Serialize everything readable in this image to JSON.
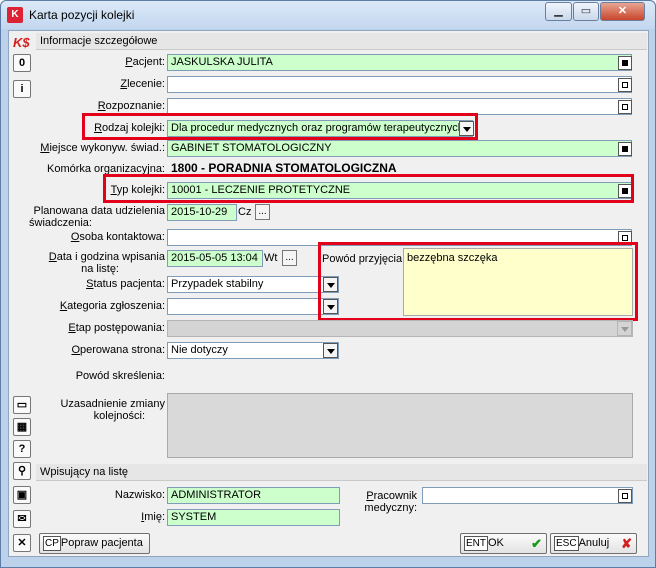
{
  "window": {
    "title": "Karta pozycji kolejki"
  },
  "toolbar": {
    "logo": "K$",
    "btn_0": "0",
    "btn_info": "i",
    "btn_help": "?"
  },
  "details": {
    "header": "Informacje szczegółowe",
    "pacjent": {
      "label": "Pacjent:",
      "value": "JASKULSKA JULITA"
    },
    "zlecenie": {
      "label": "Zlecenie:",
      "value": ""
    },
    "rozpoznanie": {
      "label": "Rozpoznanie:",
      "value": ""
    },
    "rodzaj_kolejki": {
      "label": "Rodzaj kolejki:",
      "value": "Dla procedur medycznych oraz programów terapeutycznych"
    },
    "miejsce": {
      "label": "Miejsce wykonyw. świad.:",
      "value": "GABINET STOMATOLOGICZNY"
    },
    "komorka": {
      "label": "Komórka organizacyjna:",
      "value": "1800 - PORADNIA STOMATOLOGICZNA"
    },
    "typ_kolejki": {
      "label": "Typ kolejki:",
      "value": "10001 - LECZENIE PROTETYCZNE"
    },
    "planowana_data": {
      "label_1": "Planowana data udzielenia",
      "label_2": "świadczenia:",
      "value": "2015-10-29",
      "day": "Cz",
      "more": "..."
    },
    "osoba_kontaktowa": {
      "label": "Osoba kontaktowa:",
      "value": ""
    },
    "data_wpisania": {
      "label_1": "Data i godzina wpisania",
      "label_2": "na listę:",
      "value": "2015-05-05 13:04",
      "day": "Wt",
      "more": "..."
    },
    "status_pacjenta": {
      "label": "Status pacjenta:",
      "value": "Przypadek stabilny"
    },
    "kategoria": {
      "label": "Kategoria zgłoszenia:",
      "value": ""
    },
    "etap": {
      "label": "Etap postępowania:",
      "value": ""
    },
    "operowana_strona": {
      "label": "Operowana strona:",
      "value": "Nie dotyczy"
    },
    "powod_skreslenia": {
      "label": "Powód skreślenia:"
    },
    "uzasadnienie": {
      "label_1": "Uzasadnienie zmiany",
      "label_2": "kolejności:"
    },
    "powod_przyjecia": {
      "label": "Powód przyjęcia:",
      "value": "bezzębna szczęka"
    }
  },
  "wpisujacy": {
    "header": "Wpisujący na listę",
    "nazwisko": {
      "label": "Nazwisko:",
      "value": "ADMINISTRATOR"
    },
    "imie": {
      "label": "Imię:",
      "value": "SYSTEM"
    },
    "pracownik": {
      "label_1": "Pracownik",
      "label_2": "medyczny:",
      "value": ""
    }
  },
  "buttons": {
    "popraw": {
      "key": "CP",
      "label": "Popraw pacjenta"
    },
    "ok": {
      "key": "ENT",
      "label": "OK"
    },
    "anuluj": {
      "key": "ESC",
      "label": "Anuluj"
    }
  },
  "colors": {
    "required_field": "#ccffcc",
    "highlight": "#e3001b",
    "memo": "#ffffcc"
  }
}
